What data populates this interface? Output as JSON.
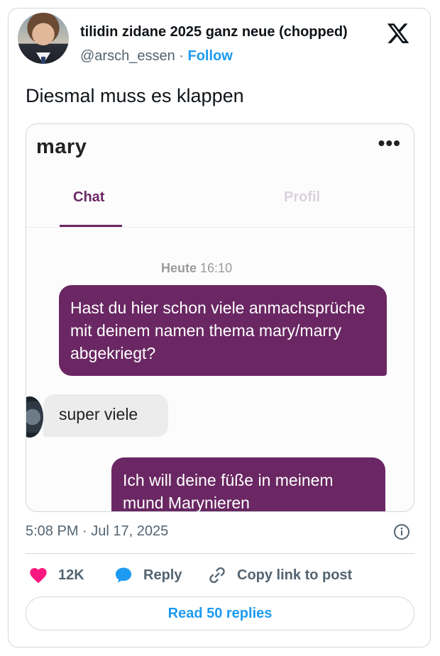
{
  "tweet": {
    "author_name": "tilidin zidane 2025 ganz neue (chopped)",
    "handle": "@arsch_essen",
    "separator": " · ",
    "follow_label": "Follow",
    "text": "Diesmal muss es klappen",
    "timestamp": "5:08 PM · Jul 17, 2025"
  },
  "embedded_chat": {
    "contact_name": "mary",
    "more_label": "•••",
    "tabs": [
      {
        "label": "Chat",
        "active": true
      },
      {
        "label": "Profil",
        "active": false
      }
    ],
    "date_label": "Heute",
    "time_label": "16:10",
    "messages": [
      {
        "direction": "out",
        "text": "Hast du hier schon viele anmachsprüche mit deinem namen thema mary/marry abgekriegt?"
      },
      {
        "direction": "in",
        "text": "super viele"
      },
      {
        "direction": "out",
        "text": "Ich will deine füße in meinem mund Marynieren"
      }
    ],
    "accent_color": "#6a2763"
  },
  "actions": {
    "like_count": "12K",
    "reply_label": "Reply",
    "copy_label": "Copy link to post",
    "read_replies_label": "Read 50 replies"
  },
  "colors": {
    "link_blue": "#1d9bf0",
    "like_pink": "#f91880",
    "secondary_text": "#536471"
  },
  "icons": [
    "x-logo-icon",
    "more-dots-icon",
    "info-icon",
    "heart-icon",
    "reply-bubble-icon",
    "link-icon"
  ]
}
